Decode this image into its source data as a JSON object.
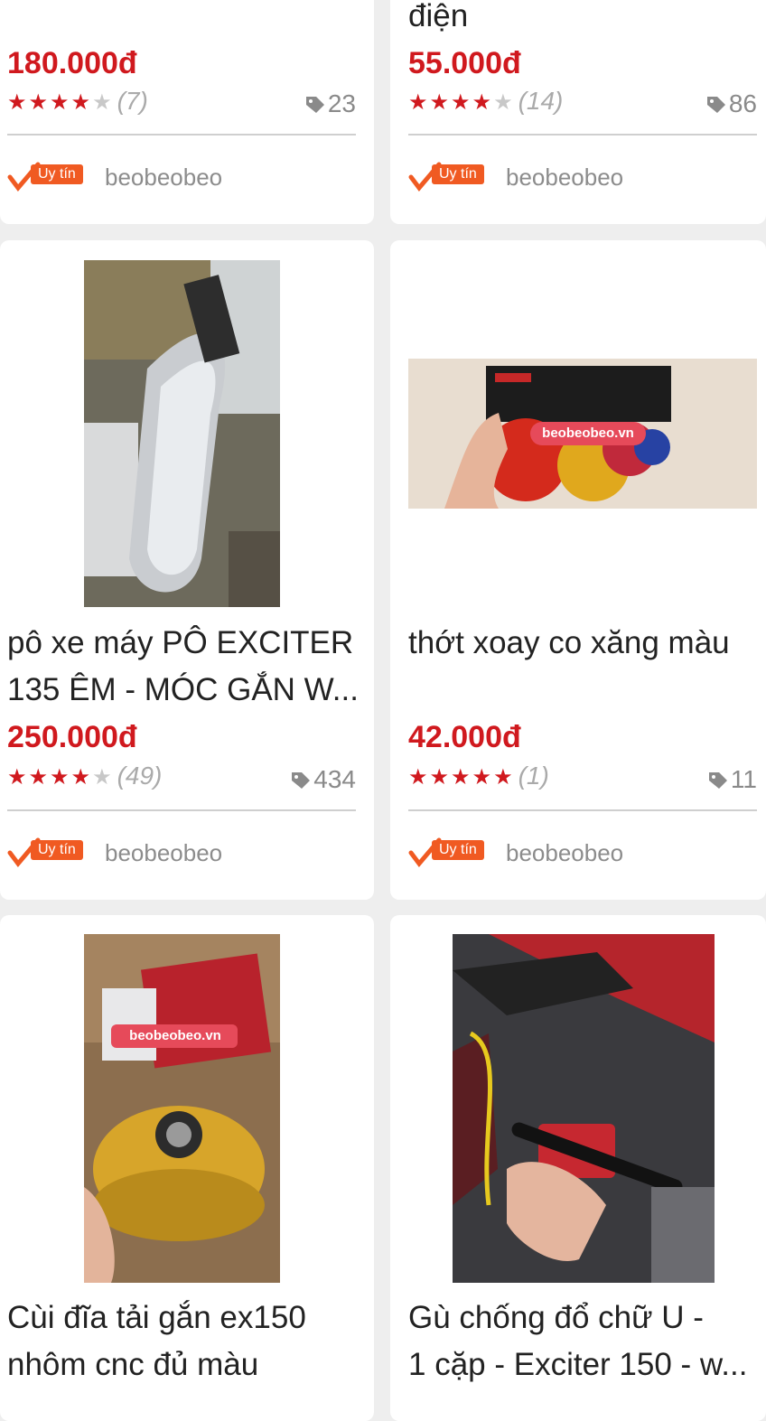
{
  "products": [
    {
      "title": "",
      "title_partial": "",
      "price": "180.000đ",
      "rating_count": "(7)",
      "stars_filled": 4,
      "sold": "23",
      "badge": "Uy tín",
      "shop": "beobeobeo"
    },
    {
      "title": "",
      "title_partial": "điện",
      "price": "55.000đ",
      "rating_count": "(14)",
      "stars_filled": 4,
      "sold": "86",
      "badge": "Uy tín",
      "shop": "beobeobeo"
    },
    {
      "title_line1": "pô xe máy PÔ EXCITER",
      "title_line2": "135 ÊM - MÓC GẮN W...",
      "price": "250.000đ",
      "rating_count": "(49)",
      "stars_filled": 4,
      "sold": "434",
      "badge": "Uy tín",
      "shop": "beobeobeo"
    },
    {
      "title_line1": "thớt xoay co xăng màu",
      "title_line2": "",
      "price": "42.000đ",
      "rating_count": "(1)",
      "stars_filled": 5,
      "sold": "11",
      "badge": "Uy tín",
      "shop": "beobeobeo",
      "image_watermark": "beobeobeo.vn"
    },
    {
      "title_line1": "Cùi đĩa tải gắn ex150",
      "title_line2": "nhôm cnc đủ màu",
      "image_watermark": "beobeobeo.vn"
    },
    {
      "title_line1": "Gù chống đổ chữ U -",
      "title_line2": "1 cặp - Exciter 150 - w..."
    }
  ],
  "colors": {
    "price": "#d0191e",
    "star_on": "#d0191e",
    "star_off": "#c8c8c8",
    "badge": "#f05a22",
    "background": "#eeeeee"
  },
  "icons": {
    "star": "star-icon",
    "sold": "tag-icon",
    "badge": "checkmark-icon"
  }
}
